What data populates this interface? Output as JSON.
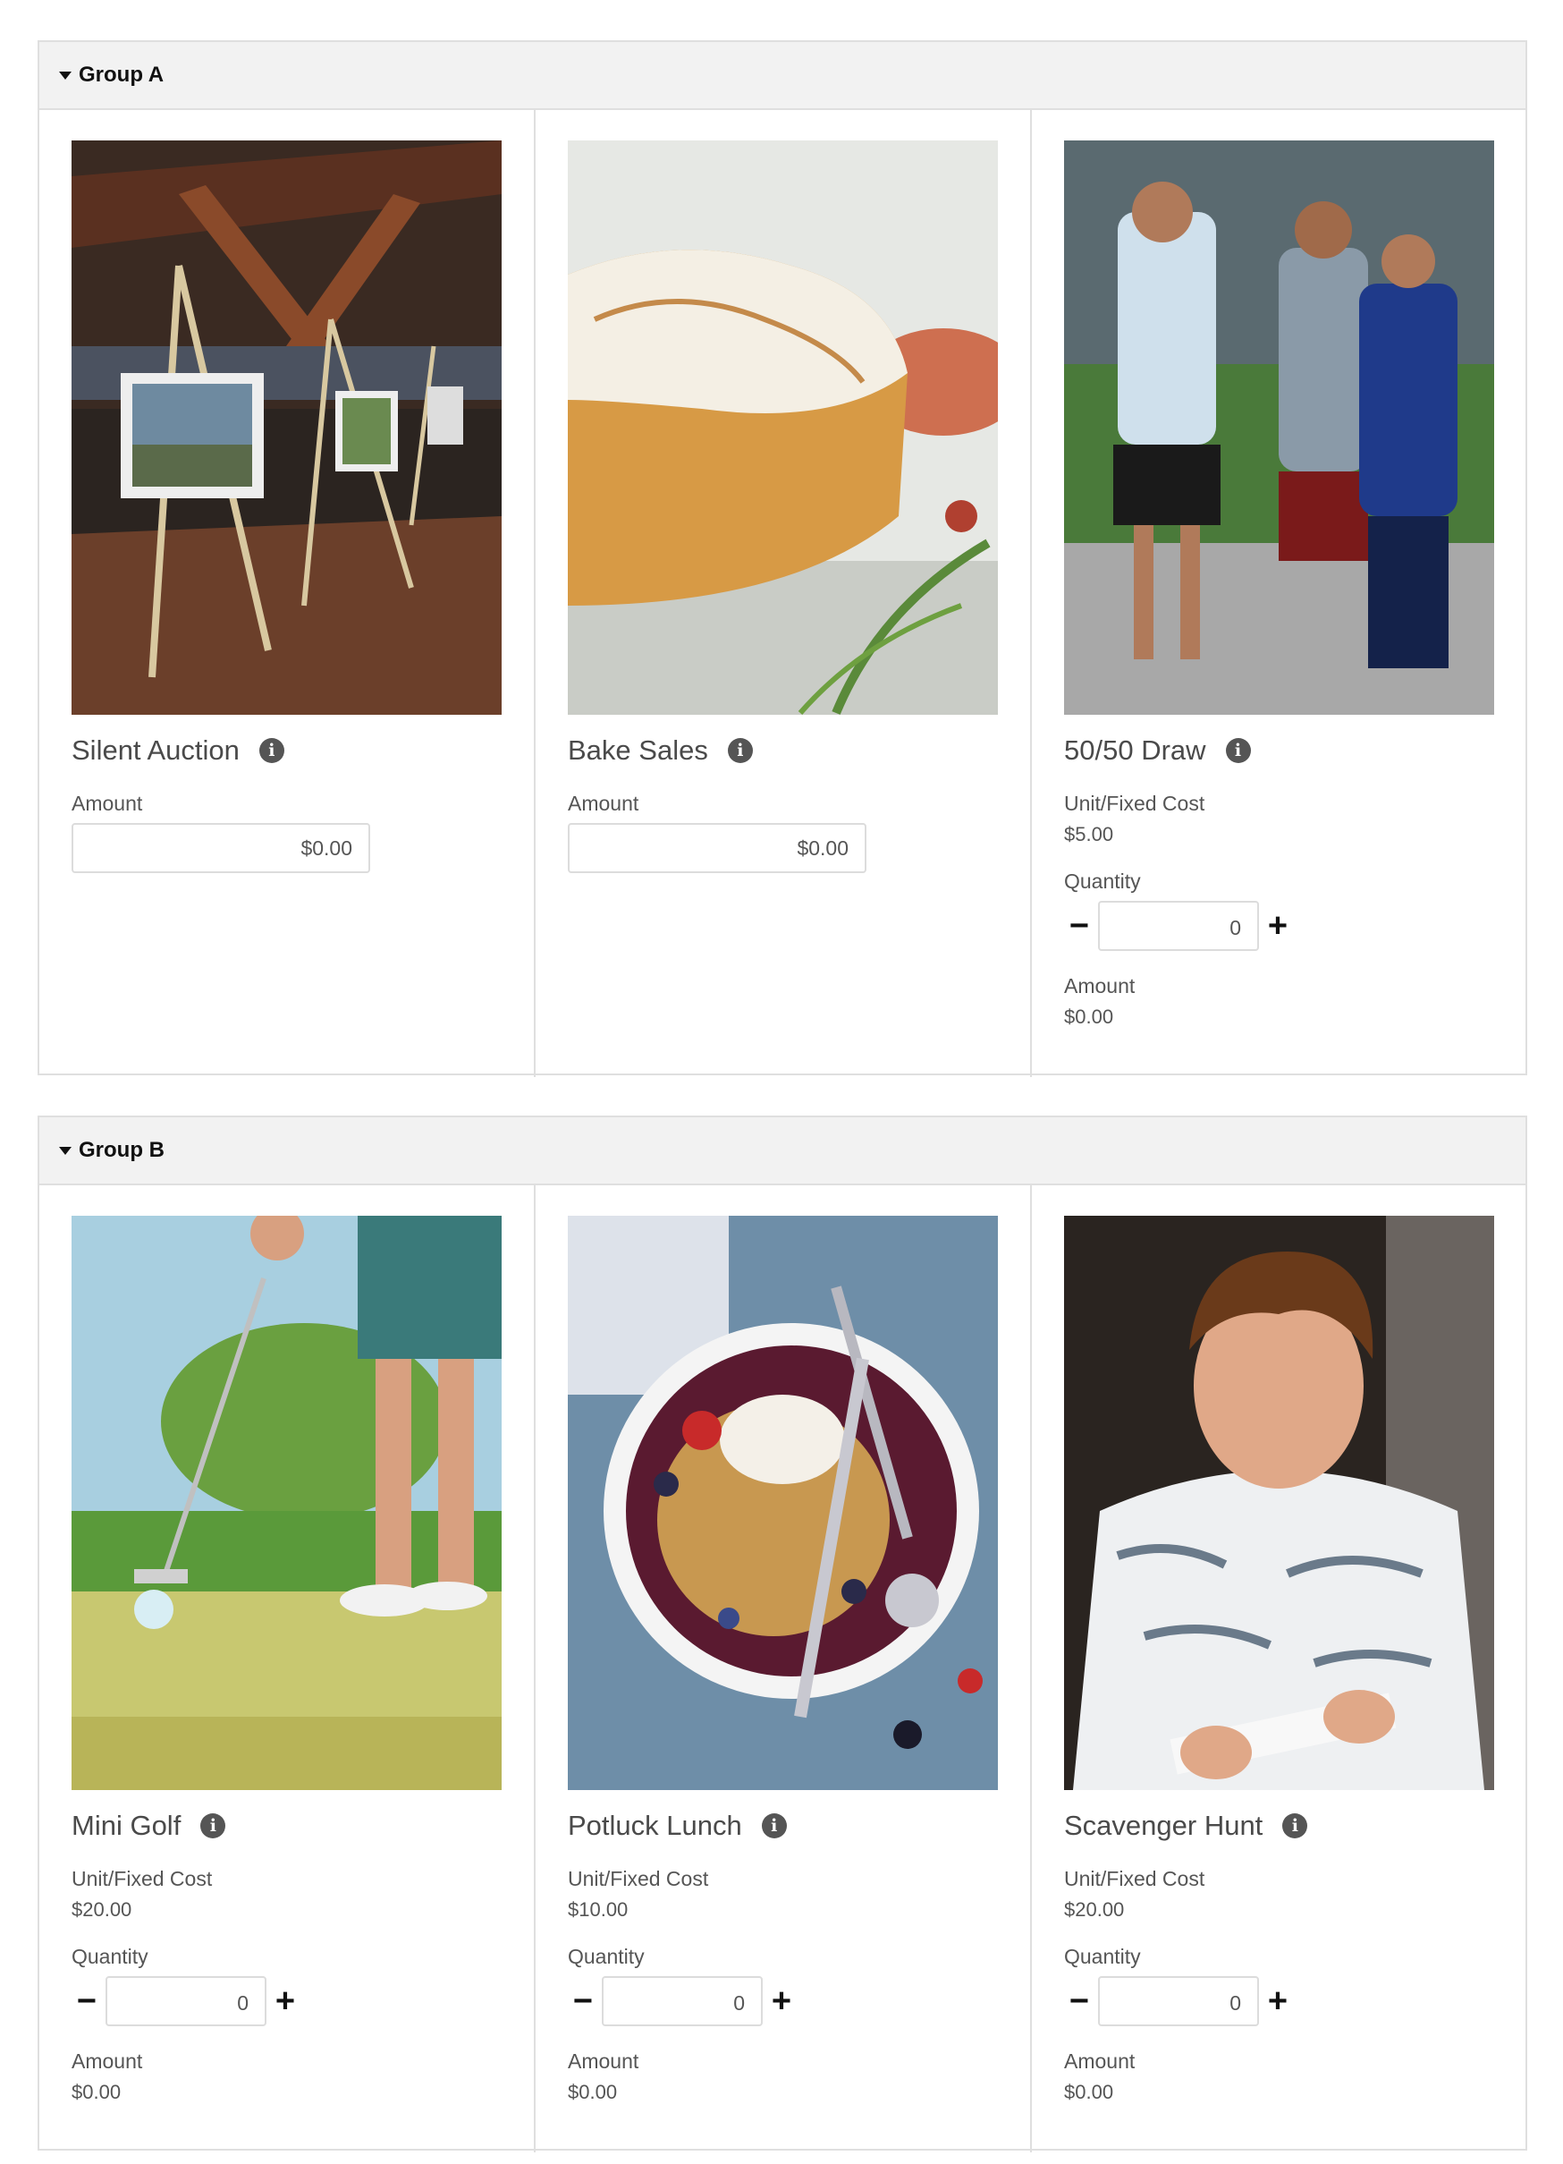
{
  "groups": [
    {
      "title": "Group A",
      "items": [
        {
          "title": "Silent Auction",
          "amount_label": "Amount",
          "amount_value": "$0.00"
        },
        {
          "title": "Bake Sales",
          "amount_label": "Amount",
          "amount_value": "$0.00"
        },
        {
          "title": "50/50 Draw",
          "unit_label": "Unit/Fixed Cost",
          "unit_value": "$5.00",
          "qty_label": "Quantity",
          "qty_value": "0",
          "amount_label": "Amount",
          "amount_value": "$0.00"
        }
      ]
    },
    {
      "title": "Group B",
      "items": [
        {
          "title": "Mini Golf",
          "unit_label": "Unit/Fixed Cost",
          "unit_value": "$20.00",
          "qty_label": "Quantity",
          "qty_value": "0",
          "amount_label": "Amount",
          "amount_value": "$0.00"
        },
        {
          "title": "Potluck Lunch",
          "unit_label": "Unit/Fixed Cost",
          "unit_value": "$10.00",
          "qty_label": "Quantity",
          "qty_value": "0",
          "amount_label": "Amount",
          "amount_value": "$0.00"
        },
        {
          "title": "Scavenger Hunt",
          "unit_label": "Unit/Fixed Cost",
          "unit_value": "$20.00",
          "qty_label": "Quantity",
          "qty_value": "0",
          "amount_label": "Amount",
          "amount_value": "$0.00"
        }
      ]
    }
  ],
  "icons": {
    "info": "info-icon",
    "caret": "caret-down-icon",
    "minus": "minus-icon",
    "plus": "plus-icon"
  },
  "symbols": {
    "info": "i",
    "minus": "−",
    "plus": "+"
  }
}
